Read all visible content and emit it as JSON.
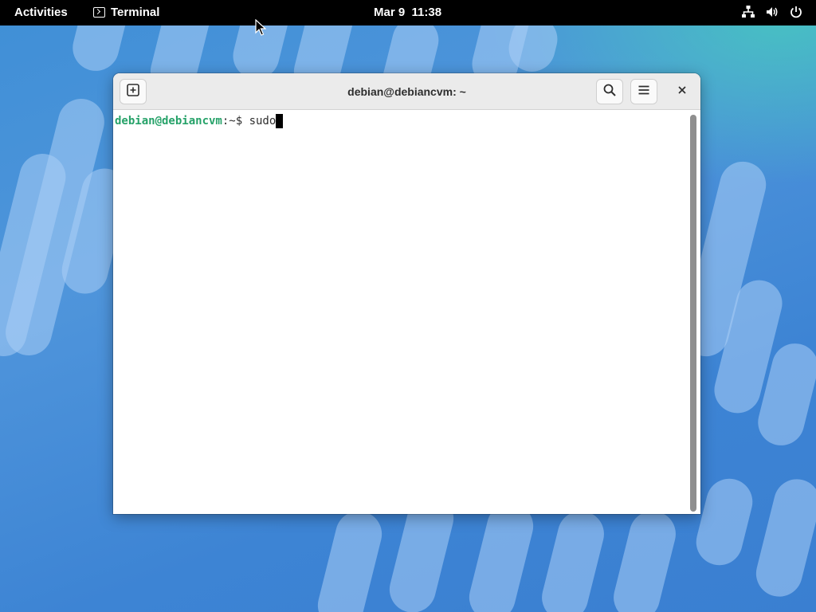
{
  "topbar": {
    "activities_label": "Activities",
    "app_name": "Terminal",
    "clock": "Mar 9  11:38",
    "tray_icons": [
      "network-icon",
      "volume-icon",
      "power-icon"
    ]
  },
  "window": {
    "title": "debian@debiancvm: ~",
    "header_buttons": [
      "new-tab-icon",
      "search-icon",
      "hamburger-menu-icon",
      "close-icon"
    ],
    "terminal": {
      "prompt_user": "debian@debiancvm",
      "prompt_path": ":~$ ",
      "command": "sudo"
    }
  },
  "colors": {
    "prompt_green": "#26a269",
    "topbar_bg": "#000000",
    "desktop_blue": "#3f8fd6"
  }
}
